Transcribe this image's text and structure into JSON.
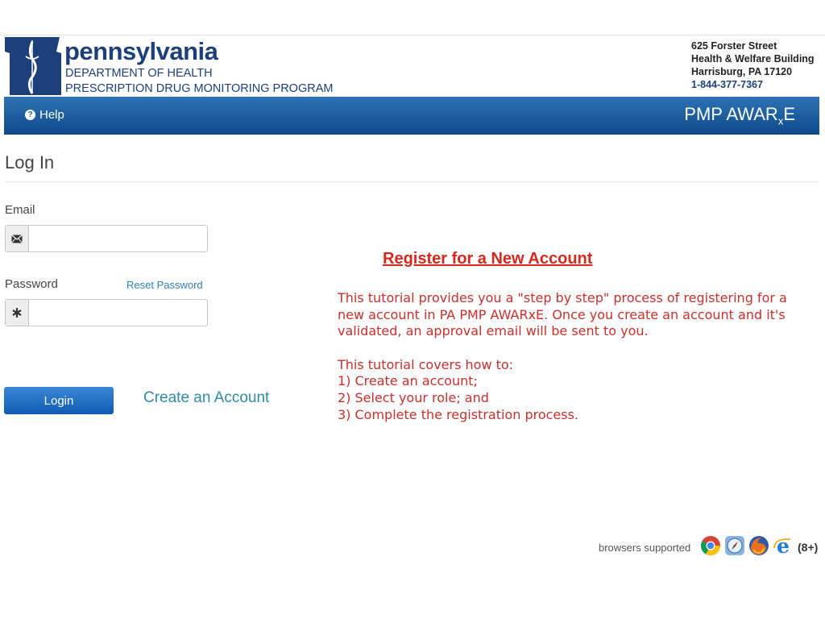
{
  "header": {
    "state_name": "pennsylvania",
    "department": "DEPARTMENT OF HEALTH",
    "program": "PRESCRIPTION DRUG MONITORING PROGRAM",
    "address": {
      "street": "625 Forster Street",
      "building": "Health & Welfare Building",
      "city": "Harrisburg, PA 17120",
      "phone": "1-844-377-7367"
    }
  },
  "navbar": {
    "help_label": "Help",
    "brand_main": "PMP AWAR",
    "brand_sub": "x",
    "brand_end": "E"
  },
  "login": {
    "title": "Log In",
    "email_label": "Email",
    "email_value": "",
    "password_label": "Password",
    "password_value": "",
    "reset_link": "Reset Password",
    "login_button": "Login",
    "create_account_link": "Create an Account"
  },
  "tutorial": {
    "title": "Register for a New Account",
    "paragraph1": "This tutorial provides you a \"step by step\" process of registering for a new account in PA PMP AWARxE. Once you create an account and it's validated, an approval email will be sent to  you.",
    "covers": "This tutorial covers how to:",
    "step1": "1) Create an account;",
    "step2": "2) Select your role; and",
    "step3": "3) Complete the registration process."
  },
  "browsers": {
    "label": "browsers supported",
    "icons": [
      "chrome-icon",
      "safari-icon",
      "firefox-icon",
      "ie-icon"
    ],
    "ie_version": "(8+)"
  },
  "colors": {
    "nav_top": "#2d73b5",
    "nav_bottom": "#0f4a8a",
    "brand_blue": "#1d3f7a",
    "tutorial_red": "#c9302b",
    "link_blue": "#2f7fb4"
  }
}
